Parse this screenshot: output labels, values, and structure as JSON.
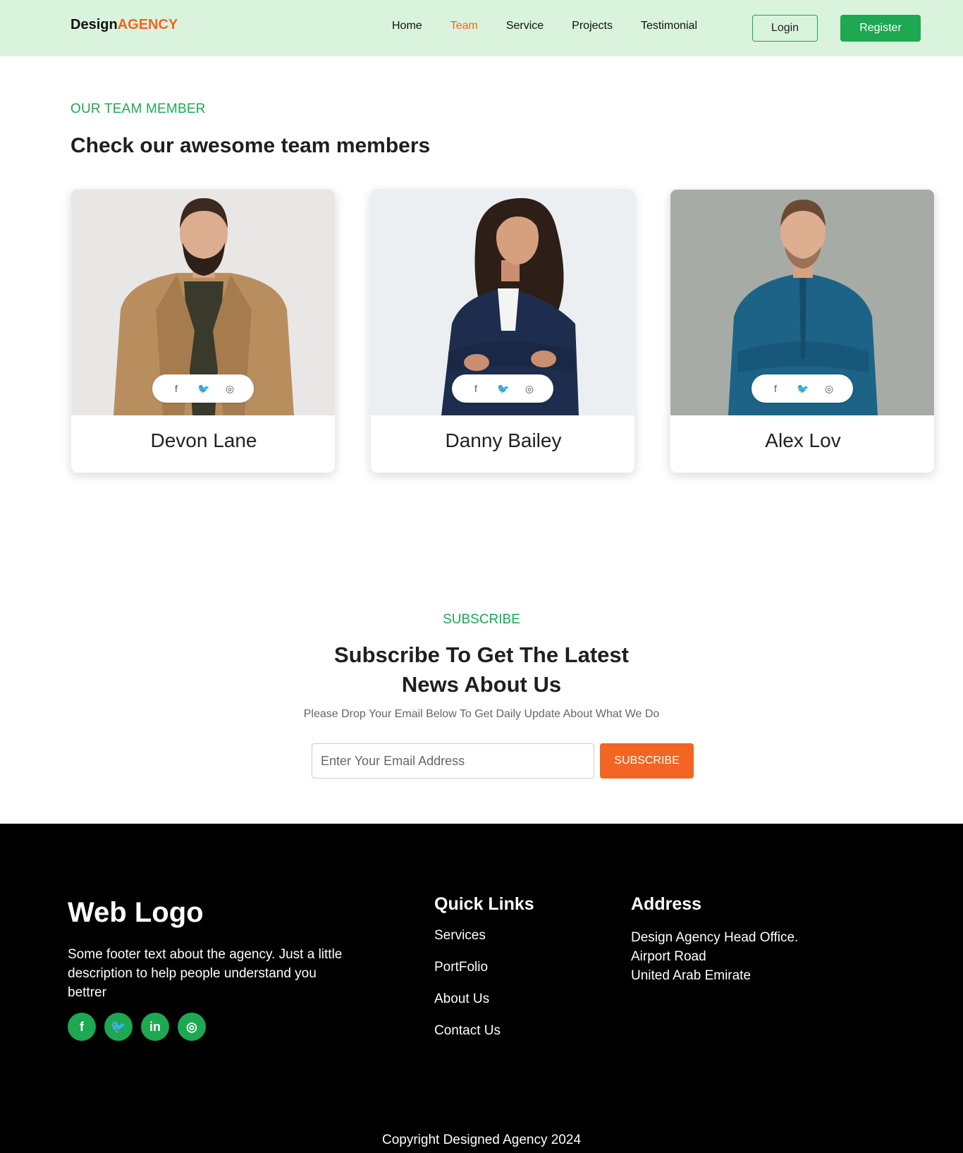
{
  "header": {
    "logo_main": "Design",
    "logo_accent": "AGENCY",
    "nav": [
      "Home",
      "Team",
      "Service",
      "Projects",
      "Testimonial"
    ],
    "active_nav": "Team",
    "login_label": "Login",
    "register_label": "Register"
  },
  "team": {
    "eyebrow": "OUR TEAM MEMBER",
    "title": "Check our awesome team members",
    "members": [
      {
        "name": "Devon Lane"
      },
      {
        "name": "Danny Bailey"
      },
      {
        "name": "Alex Lov"
      }
    ],
    "social_icons": [
      "facebook-icon",
      "twitter-icon",
      "instagram-icon"
    ]
  },
  "subscribe": {
    "eyebrow": "SUBSCRIBE",
    "title_line1": "Subscribe To Get The Latest",
    "title_line2": "News About Us",
    "description": "Please Drop Your Email Below To Get Daily Update About What We Do",
    "email_placeholder": "Enter Your Email Address",
    "button_label": "SUBSCRIBE"
  },
  "footer": {
    "logo": "Web Logo",
    "text": "Some footer text about the agency. Just a little description to help people understand you bettrer",
    "social_icons": [
      "facebook-icon",
      "twitter-icon",
      "linkedin-icon",
      "instagram-icon"
    ],
    "quick_links_heading": "Quick Links",
    "quick_links": [
      "Services",
      "PortFolio",
      "About Us",
      "Contact Us"
    ],
    "address_heading": "Address",
    "address_lines": [
      "Design Agency Head Office.",
      "Airport Road",
      "United Arab Emirate"
    ],
    "copyright": "Copyright Designed Agency 2024"
  },
  "colors": {
    "brand_green": "#1da851",
    "accent_orange": "#f26522",
    "header_bg": "#d9f3dc",
    "footer_bg": "#000000"
  }
}
